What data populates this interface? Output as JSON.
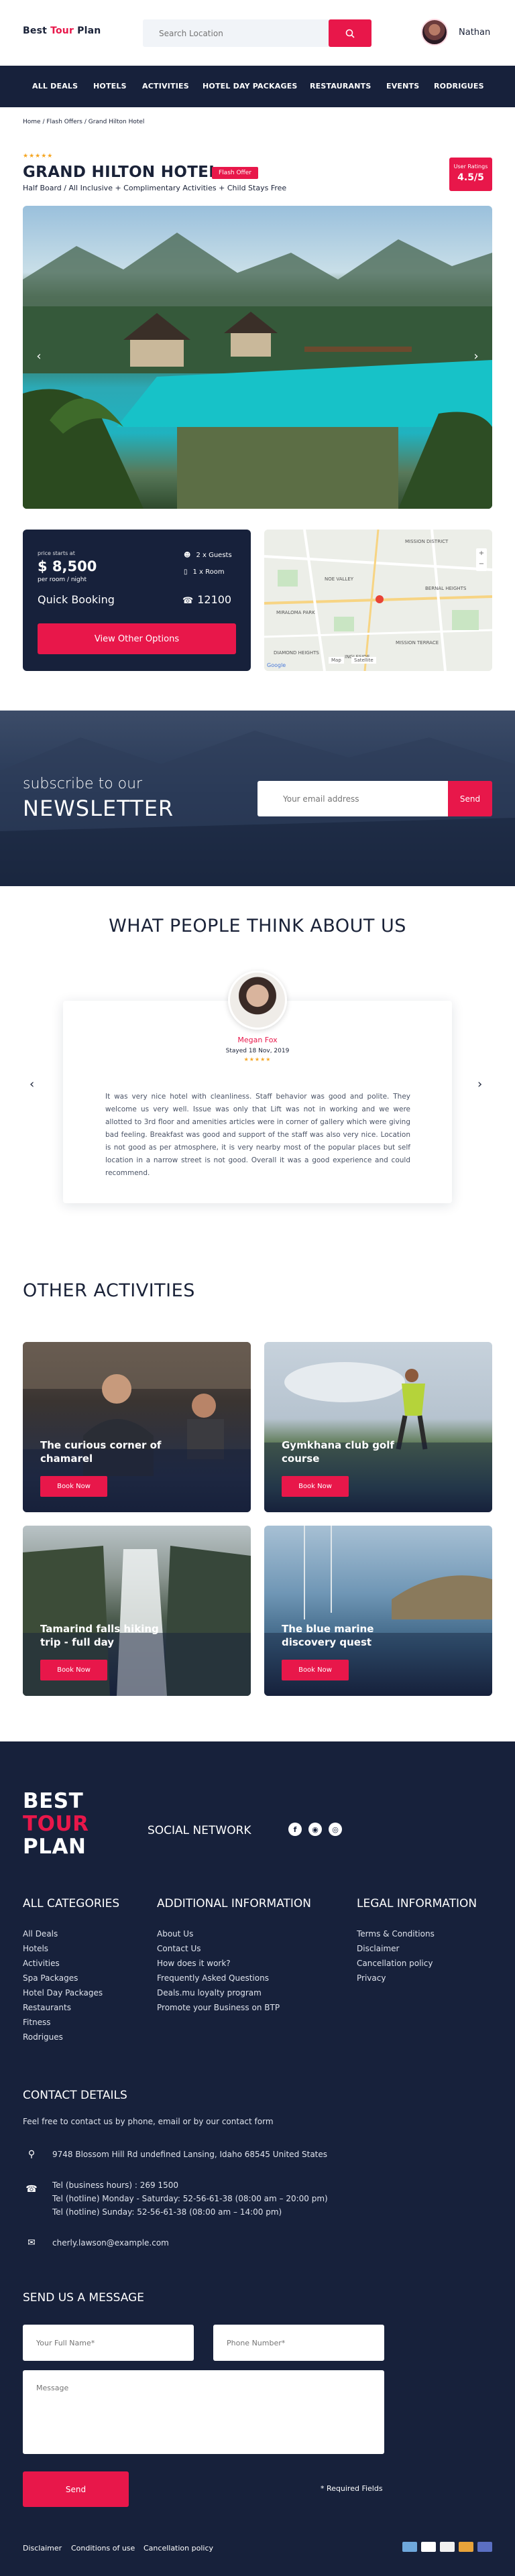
{
  "brand": {
    "part1": "Best ",
    "part2": "Tour",
    "part3": " Plan"
  },
  "search": {
    "placeholder": "Search Location"
  },
  "user": {
    "name": "Nathan"
  },
  "nav": [
    "ALL DEALS",
    "HOTELS",
    "ACTIVITIES",
    "HOTEL DAY PACKAGES",
    "RESTAURANTS",
    "EVENTS",
    "RODRIGUES"
  ],
  "breadcrumb": "Home / Flash Offers / Grand Hilton Hotel",
  "hotel": {
    "stars": "★★★★★",
    "name": "GRAND HILTON HOTEL",
    "badge": "Flash Offer",
    "subtitle": "Half Board / All Inclusive + Complimentary Activities + Child Stays Free",
    "rating_label": "User Ratings",
    "rating_value": "4.5/5"
  },
  "gallery": {
    "prev": "‹",
    "next": "›"
  },
  "booking": {
    "price_from": "price starts at",
    "price": "$ 8,500",
    "per_room": "per room / night",
    "guests": "2 x Guests",
    "rooms": "1 x Room",
    "quick": "Quick Booking",
    "phone": "12100",
    "button": "View Other Options"
  },
  "map": {
    "labels": [
      "DIAMOND HEIGHTS",
      "NOE VALLEY",
      "MISSION DISTRICT",
      "MIRALOMA PARK",
      "MISSION TERRACE",
      "BERNAL HEIGHTS",
      "INGLESIDE"
    ],
    "street_view": "Satellite",
    "map_view": "Map",
    "google": "Google"
  },
  "newsletter": {
    "small": "subscribe to our",
    "big": "NEWSLETTER",
    "placeholder": "Your email address",
    "button": "Send"
  },
  "testimonials": {
    "title": "WHAT PEOPLE THINK ABOUT US",
    "name": "Megan Fox",
    "date": "Stayed 18 Nov, 2019",
    "stars": "★★★★★",
    "text": "It was very nice hotel with cleanliness. Staff behavior was good and polite. They welcome us very well. Issue was only that Lift was not in working and we were allotted to 3rd floor and amenities articles were in corner of gallery which were giving bad feeling. Breakfast was good and support of the staff was also very nice. Location is not good as per atmosphere, it is very nearby most of the popular places but self location in a narrow street is not good. Overall it was a good experience and could recommend.",
    "prev": "‹",
    "next": "›"
  },
  "activities": {
    "title": "OTHER ACTIVITIES",
    "button": "Book Now",
    "items": [
      {
        "title": "The curious corner of chamarel"
      },
      {
        "title": "Gymkhana club golf course"
      },
      {
        "title": "Tamarind falls hiking trip - full day"
      },
      {
        "title": "The blue marine discovery quest"
      }
    ]
  },
  "footer": {
    "logo": [
      "BEST",
      "TOUR",
      "PLAN"
    ],
    "social_title": "SOCIAL NETWORK",
    "social_icons": [
      "f",
      "◉",
      "◎"
    ],
    "cols": [
      {
        "title": "ALL CATEGORIES",
        "items": [
          "All Deals",
          "Hotels",
          "Activities",
          "Spa Packages",
          "Hotel Day Packages",
          "Restaurants",
          "Fitness",
          "Rodrigues"
        ]
      },
      {
        "title": "ADDITIONAL INFORMATION",
        "items": [
          "About Us",
          "Contact Us",
          "How does it work?",
          "Frequently Asked Questions",
          "Deals.mu loyalty program",
          "Promote your Business on BTP"
        ]
      },
      {
        "title": "LEGAL INFORMATION",
        "items": [
          "Terms & Conditions",
          "Disclaimer",
          "Cancellation policy",
          "Privacy"
        ]
      }
    ],
    "contact_title": "CONTACT DETAILS",
    "contact_sub": "Feel free to contact us by phone, email or by our contact form",
    "address": "9748 Blossom Hill Rd undefined Lansing, Idaho 68545 United States",
    "phone1": "Tel (business hours) : 269 1500",
    "phone2": "Tel (hotline) Monday - Saturday: 52-56-61-38 (08:00 am – 20:00 pm)",
    "phone3": "Tel (hotline) Sunday: 52-56-61-38 (08:00 am – 14:00 pm)",
    "email": "cherly.lawson@example.com",
    "msg_title": "SEND US A MESSAGE",
    "name_ph": "Your Full Name*",
    "phone_ph": "Phone Number*",
    "message_ph": "Message",
    "send": "Send",
    "required": "* Required Fields",
    "legal": [
      "Disclaimer",
      "Conditions of use",
      "Cancellation policy"
    ]
  }
}
